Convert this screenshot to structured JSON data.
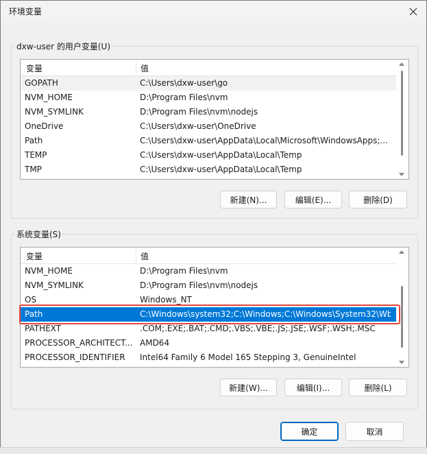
{
  "window": {
    "title": "环境变量"
  },
  "user_group": {
    "label": "dxw-user 的用户变量(U)",
    "columns": [
      "变量",
      "值"
    ],
    "rows": [
      {
        "name": "GOPATH",
        "value": "C:\\Users\\dxw-user\\go"
      },
      {
        "name": "NVM_HOME",
        "value": "D:\\Program Files\\nvm"
      },
      {
        "name": "NVM_SYMLINK",
        "value": "D:\\Program Files\\nvm\\nodejs"
      },
      {
        "name": "OneDrive",
        "value": "C:\\Users\\dxw-user\\OneDrive"
      },
      {
        "name": "Path",
        "value": "C:\\Users\\dxw-user\\AppData\\Local\\Microsoft\\WindowsApps;..."
      },
      {
        "name": "TEMP",
        "value": "C:\\Users\\dxw-user\\AppData\\Local\\Temp"
      },
      {
        "name": "TMP",
        "value": "C:\\Users\\dxw-user\\AppData\\Local\\Temp"
      }
    ],
    "buttons": {
      "new": "新建(N)...",
      "edit": "编辑(E)...",
      "delete": "删除(D)"
    }
  },
  "system_group": {
    "label": "系统变量(S)",
    "columns": [
      "变量",
      "值"
    ],
    "rows": [
      {
        "name": "NVM_HOME",
        "value": "D:\\Program Files\\nvm"
      },
      {
        "name": "NVM_SYMLINK",
        "value": "D:\\Program Files\\nvm\\nodejs"
      },
      {
        "name": "OS",
        "value": "Windows_NT"
      },
      {
        "name": "Path",
        "value": "C:\\Windows\\system32;C:\\Windows;C:\\Windows\\System32\\Wb..."
      },
      {
        "name": "PATHEXT",
        "value": ".COM;.EXE;.BAT;.CMD;.VBS;.VBE;.JS;.JSE;.WSF;.WSH;.MSC"
      },
      {
        "name": "PROCESSOR_ARCHITECT...",
        "value": "AMD64"
      },
      {
        "name": "PROCESSOR_IDENTIFIER",
        "value": "Intel64 Family 6 Model 165 Stepping 3, GenuineIntel"
      }
    ],
    "selected_row": "Path",
    "buttons": {
      "new": "新建(W)...",
      "edit": "编辑(I)...",
      "delete": "删除(L)"
    }
  },
  "footer": {
    "ok": "确定",
    "cancel": "取消"
  },
  "colors": {
    "selection": "#0078d7",
    "highlight_outline": "#e5463a",
    "primary_border": "#0067c0"
  }
}
